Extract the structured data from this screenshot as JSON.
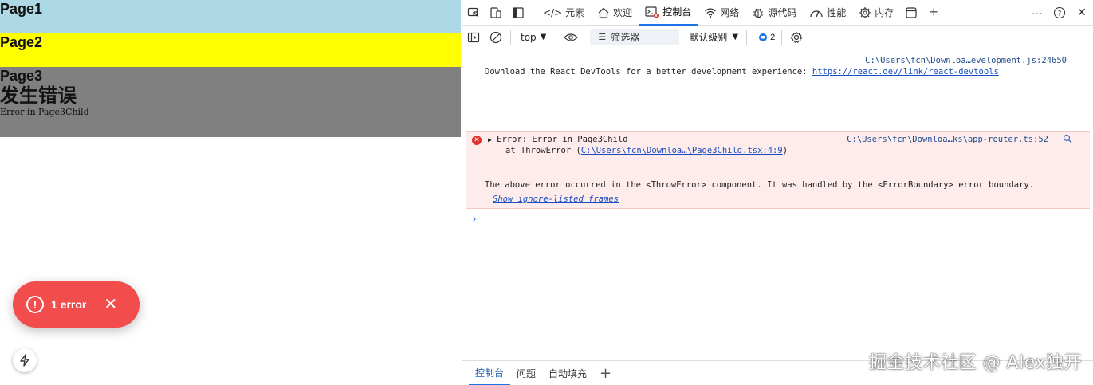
{
  "app": {
    "page1": "Page1",
    "page2": "Page2",
    "page3": "Page3",
    "error_title": "发生错误",
    "error_message": "Error in Page3Child",
    "toast_label": "1 error",
    "colors": {
      "page1": "#add8e6",
      "page2": "#ffff00",
      "page3": "#808080",
      "toast": "#f24c4c"
    }
  },
  "devtools": {
    "tabs": [
      {
        "label": "元素",
        "icon": "code-icon"
      },
      {
        "label": "欢迎",
        "icon": "home-icon"
      },
      {
        "label": "控制台",
        "icon": "console-icon",
        "active": true
      },
      {
        "label": "网络",
        "icon": "wifi-icon"
      },
      {
        "label": "源代码",
        "icon": "bug-icon"
      },
      {
        "label": "性能",
        "icon": "gauge-icon"
      },
      {
        "label": "内存",
        "icon": "chip-icon"
      }
    ],
    "toolbar": {
      "context": "top",
      "filter_placeholder": "筛选器",
      "level": "默认级别",
      "issues_count": "2"
    },
    "console": {
      "msg1_source": "C:\\Users\\fcn\\Downloa…evelopment.js:24650",
      "msg1_text": "Download the React DevTools for a better development experience: ",
      "msg1_link": "https://react.dev/link/react-devtools",
      "err_line1": "Error: Error in Page3Child",
      "err_line2_prefix": "at ThrowError (",
      "err_line2_link": "C:\\Users\\fcn\\Downloa…\\Page3Child.tsx:4:9",
      "err_line2_suffix": ")",
      "err_source": "C:\\Users\\fcn\\Downloa…ks\\app-router.ts:52",
      "err_line3": "The above error occurred in the <ThrowError> component. It was handled by the <ErrorBoundary> error boundary.",
      "err_line4": "Show ignore-listed frames"
    },
    "drawer": {
      "tabs": [
        "控制台",
        "问题",
        "自动填充"
      ]
    }
  },
  "watermark": "掘金技术社区 @ Alex独开"
}
